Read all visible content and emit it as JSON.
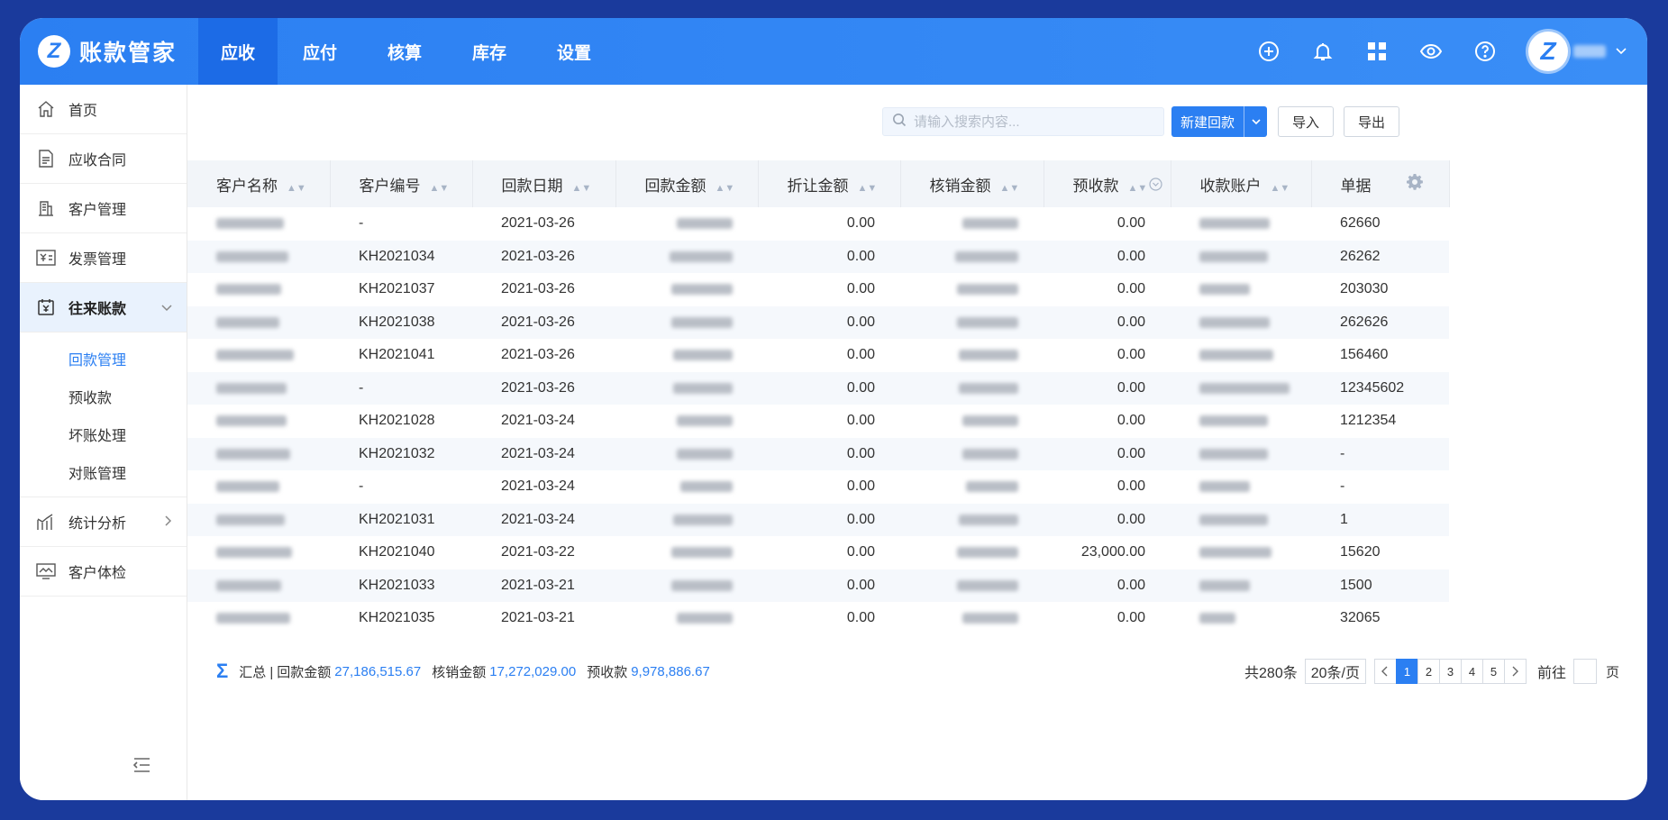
{
  "brand": {
    "logo": "Z",
    "name": "账款管家"
  },
  "nav": [
    {
      "label": "应收",
      "active": true
    },
    {
      "label": "应付"
    },
    {
      "label": "核算"
    },
    {
      "label": "库存"
    },
    {
      "label": "设置"
    }
  ],
  "top_icons": [
    "add-circle-icon",
    "bell-icon",
    "apps-grid-icon",
    "eye-icon",
    "help-icon"
  ],
  "user": {
    "avatar_letter": "Z"
  },
  "sidebar": {
    "items": [
      {
        "label": "首页",
        "icon": "home-icon"
      },
      {
        "label": "应收合同",
        "icon": "document-icon"
      },
      {
        "label": "客户管理",
        "icon": "building-icon"
      },
      {
        "label": "发票管理",
        "icon": "invoice-icon"
      },
      {
        "label": "往来账款",
        "icon": "ledger-icon"
      },
      {
        "label": "统计分析",
        "icon": "chart-icon"
      },
      {
        "label": "客户体检",
        "icon": "monitor-icon"
      }
    ],
    "sub_items": [
      {
        "label": "回款管理",
        "active": true
      },
      {
        "label": "预收款"
      },
      {
        "label": "坏账处理"
      },
      {
        "label": "对账管理"
      }
    ]
  },
  "toolbar": {
    "search_placeholder": "请输入搜索内容...",
    "new_label": "新建回款",
    "import_label": "导入",
    "export_label": "导出"
  },
  "table": {
    "columns": [
      "客户名称",
      "客户编号",
      "回款日期",
      "回款金额",
      "折让金额",
      "核销金额",
      "预收款",
      "收款账户",
      "单据"
    ],
    "rows": [
      [
        "",
        "-",
        "2021-03-26",
        "",
        "0.00",
        "",
        "0.00",
        "",
        "62660"
      ],
      [
        "",
        "KH2021034",
        "2021-03-26",
        "",
        "0.00",
        "",
        "0.00",
        "",
        "26262"
      ],
      [
        "",
        "KH2021037",
        "2021-03-26",
        "",
        "0.00",
        "",
        "0.00",
        "",
        "203030"
      ],
      [
        "",
        "KH2021038",
        "2021-03-26",
        "",
        "0.00",
        "",
        "0.00",
        "",
        "262626"
      ],
      [
        "",
        "KH2021041",
        "2021-03-26",
        "",
        "0.00",
        "",
        "0.00",
        "",
        "156460"
      ],
      [
        "",
        "-",
        "2021-03-26",
        "",
        "0.00",
        "",
        "0.00",
        "",
        "12345602"
      ],
      [
        "",
        "KH2021028",
        "2021-03-24",
        "",
        "0.00",
        "",
        "0.00",
        "",
        "1212354"
      ],
      [
        "",
        "KH2021032",
        "2021-03-24",
        "",
        "0.00",
        "",
        "0.00",
        "",
        "-"
      ],
      [
        "",
        "-",
        "2021-03-24",
        "",
        "0.00",
        "",
        "0.00",
        "",
        "-"
      ],
      [
        "",
        "KH2021031",
        "2021-03-24",
        "",
        "0.00",
        "",
        "0.00",
        "",
        "1"
      ],
      [
        "",
        "KH2021040",
        "2021-03-22",
        "",
        "0.00",
        "",
        "23,000.00",
        "",
        "15620"
      ],
      [
        "",
        "KH2021033",
        "2021-03-21",
        "",
        "0.00",
        "",
        "0.00",
        "",
        "1500"
      ],
      [
        "",
        "KH2021035",
        "2021-03-21",
        "",
        "0.00",
        "",
        "0.00",
        "",
        "32065"
      ]
    ]
  },
  "summary": {
    "title": "汇总 |",
    "received_label": "回款金额",
    "received_value": "27,186,515.67",
    "writeoff_label": "核销金额",
    "writeoff_value": "17,272,029.00",
    "prepaid_label": "预收款",
    "prepaid_value": "9,978,886.67"
  },
  "pager": {
    "total": "共280条",
    "page_size": "20条/页",
    "pages": [
      "1",
      "2",
      "3",
      "4",
      "5"
    ],
    "current": "1",
    "goto_label": "前往",
    "page_unit": "页"
  },
  "colors": {
    "primary": "#2b7ff2",
    "nav_active": "#1c6be6",
    "frame": "#1a3a9c"
  }
}
